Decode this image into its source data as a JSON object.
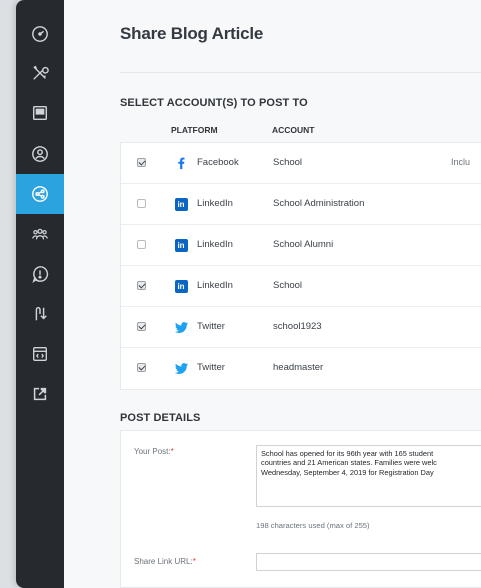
{
  "page": {
    "title": "Share Blog Article"
  },
  "sidebar": {
    "items": [
      {
        "icon": "dashboard-icon",
        "active": false
      },
      {
        "icon": "tools-icon",
        "active": false
      },
      {
        "icon": "content-icon",
        "active": false
      },
      {
        "icon": "user-icon",
        "active": false
      },
      {
        "icon": "share-icon",
        "active": true
      },
      {
        "icon": "users-icon",
        "active": false
      },
      {
        "icon": "alert-icon",
        "active": false
      },
      {
        "icon": "sort-icon",
        "active": false
      },
      {
        "icon": "code-icon",
        "active": false
      },
      {
        "icon": "external-link-icon",
        "active": false
      }
    ]
  },
  "accounts": {
    "heading": "SELECT ACCOUNT(S) TO POST TO",
    "col_platform": "PLATFORM",
    "col_account": "ACCOUNT",
    "rows": [
      {
        "checked": true,
        "platform": "Facebook",
        "account": "School",
        "extra": "Inclu"
      },
      {
        "checked": false,
        "platform": "LinkedIn",
        "account": "School Administration"
      },
      {
        "checked": false,
        "platform": "LinkedIn",
        "account": "School Alumni"
      },
      {
        "checked": true,
        "platform": "LinkedIn",
        "account": "School"
      },
      {
        "checked": true,
        "platform": "Twitter",
        "account": "school1923"
      },
      {
        "checked": true,
        "platform": "Twitter",
        "account": "headmaster"
      }
    ]
  },
  "details": {
    "heading": "POST DETAILS",
    "post_label": "Your Post:",
    "required_mark": "*",
    "post_lines": [
      "School has opened for its 96th year with 165 student",
      "countries and 21 American states. Families were welc",
      "Wednesday, September 4, 2019 for Registration Day"
    ],
    "char_count": "198 characters used (max of 255)",
    "url_label": "Share Link URL:",
    "url_value": ""
  },
  "colors": {
    "sidebar_bg": "#262a2f",
    "active": "#2aa3df",
    "facebook": "#1877f2",
    "linkedin": "#0a66c2",
    "twitter": "#1da1f2",
    "required": "#e53935"
  }
}
